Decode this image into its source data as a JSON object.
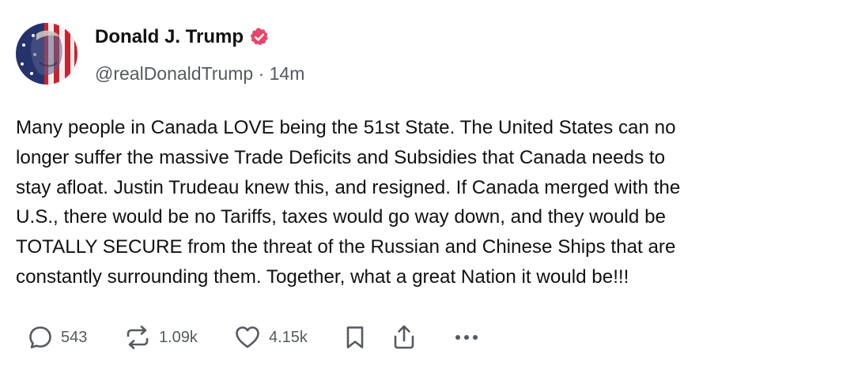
{
  "post": {
    "author": {
      "display_name": "Donald J. Trump",
      "verified": true,
      "handle": "@realDonaldTrump",
      "time_separator": "·",
      "time": "14m",
      "avatar": "avatar-flag-portrait"
    },
    "text": "Many people in Canada LOVE being the 51st State. The United States can no\nlonger suffer the massive Trade Deficits and Subsidies that Canada needs to\nstay afloat. Justin Trudeau knew this, and resigned. If Canada merged with the\nU.S., there would be no Tariffs, taxes would go way down, and they would be\nTOTALLY SECURE from the threat of the Russian and Chinese Ships that are\nconstantly surrounding them. Together, what a great Nation it would be!!!",
    "actions": {
      "reply": {
        "icon": "reply-icon",
        "count": "543"
      },
      "repost": {
        "icon": "repost-icon",
        "count": "1.09k"
      },
      "like": {
        "icon": "heart-icon",
        "count": "4.15k"
      },
      "bookmark": {
        "icon": "bookmark-icon"
      },
      "share": {
        "icon": "share-icon"
      },
      "more": {
        "icon": "more-icon"
      }
    }
  },
  "colors": {
    "verified_badge": "#e8456b",
    "text_primary": "#111111",
    "text_secondary": "#555a60"
  }
}
